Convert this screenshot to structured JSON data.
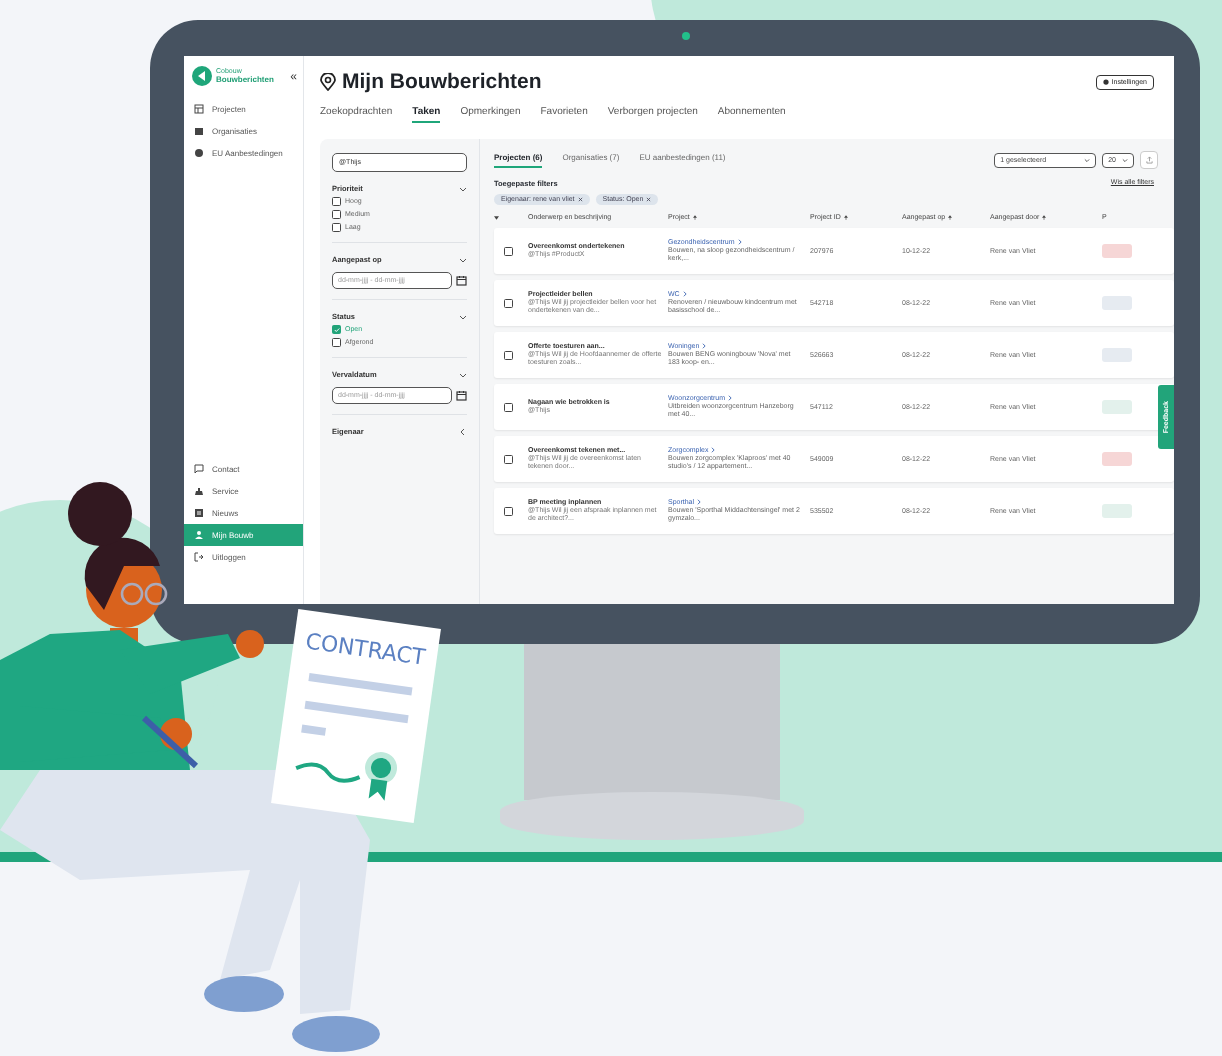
{
  "sidebar": {
    "logo_brand": "Cobouw",
    "logo_name": "Bouwberichten",
    "collapse_glyph": "«",
    "items": [
      {
        "label": "Projecten",
        "selected": false
      },
      {
        "label": "Organisaties",
        "selected": false
      },
      {
        "label": "EU Aanbestedingen",
        "selected": false
      }
    ],
    "bottom_items": [
      {
        "label": "Contact",
        "selected": false
      },
      {
        "label": "Service",
        "selected": false
      },
      {
        "label": "Nieuws",
        "selected": false
      },
      {
        "label": "Mijn Bouwb",
        "selected": true
      },
      {
        "label": "Uitloggen",
        "selected": false
      }
    ]
  },
  "header": {
    "title": "Mijn Bouwberichten",
    "settings_button": "Instellingen"
  },
  "tabs": [
    {
      "label": "Zoekopdrachten",
      "selected": false
    },
    {
      "label": "Taken",
      "selected": true
    },
    {
      "label": "Opmerkingen",
      "selected": false
    },
    {
      "label": "Favorieten",
      "selected": false
    },
    {
      "label": "Verborgen projecten",
      "selected": false
    },
    {
      "label": "Abonnementen",
      "selected": false
    }
  ],
  "filters": {
    "search": {
      "value": "@Thijs"
    },
    "sections": [
      {
        "title": "Prioriteit",
        "expanded": true,
        "kind": "checkboxes",
        "options": [
          {
            "label": "Hoog",
            "checked": false
          },
          {
            "label": "Medium",
            "checked": false
          },
          {
            "label": "Laag",
            "checked": false
          }
        ]
      },
      {
        "title": "Aangepast op",
        "expanded": true,
        "kind": "date",
        "placeholder": "dd-mm-jjjj - dd-mm-jjjj"
      },
      {
        "title": "Status",
        "expanded": true,
        "kind": "checkboxes",
        "options": [
          {
            "label": "Open",
            "checked": true
          },
          {
            "label": "Afgerond",
            "checked": false
          }
        ]
      },
      {
        "title": "Vervaldatum",
        "expanded": true,
        "kind": "date",
        "placeholder": "dd-mm-jjjj - dd-mm-jjjj"
      },
      {
        "title": "Eigenaar",
        "expanded": false,
        "kind": "none"
      }
    ]
  },
  "results": {
    "tabs": [
      {
        "label": "Projecten (6)",
        "selected": true
      },
      {
        "label": "Organisaties (7)",
        "selected": false
      },
      {
        "label": "EU aanbestedingen (11)",
        "selected": false
      }
    ],
    "selection_dropdown": "1 geselecteerd",
    "page_size_dropdown": "20",
    "applied_filters_label": "Toegepaste filters",
    "clear_filters_link": "Wis alle filters",
    "chips": [
      "Eigenaar: rene van vliet",
      "Status: Open"
    ],
    "table": {
      "columns": [
        {
          "label": "Onderwerp en beschrijving",
          "sortable": false
        },
        {
          "label": "Project",
          "sortable": true
        },
        {
          "label": "Project ID",
          "sortable": true
        },
        {
          "label": "Aangepast op",
          "sortable": true
        },
        {
          "label": "Aangepast door",
          "sortable": true
        },
        {
          "label": "P",
          "sortable": false
        }
      ],
      "rows": [
        {
          "selected": false,
          "subject": "Overeenkomst ondertekenen",
          "note": "@Thijs #ProductX",
          "project": "Gezondheidscentrum",
          "project_description": "Bouwen, na sloop gezondheidscentrum / kerk,...",
          "project_id": "207976",
          "modified_on": "10-12-22",
          "modified_by": "Rene van Vliet",
          "color": "#f6d6d6"
        },
        {
          "selected": false,
          "subject": "Projectleider bellen",
          "note": "@Thijs Wil jij projectleider bellen voor het ondertekenen van de...",
          "project": "WC",
          "project_description": "Renoveren / nieuwbouw kindcentrum met basisschool de...",
          "project_id": "542718",
          "modified_on": "08-12-22",
          "modified_by": "Rene van Vliet",
          "color": "#e6ebf1"
        },
        {
          "selected": false,
          "subject": "Offerte toesturen aan...",
          "note": "@Thijs Wil jij de Hoofdaannemer de offerte toesturen zoals...",
          "project": "Woningen",
          "project_description": "Bouwen BENG woningbouw 'Nova' met 183 koop- en...",
          "project_id": "526663",
          "modified_on": "08-12-22",
          "modified_by": "Rene van Vliet",
          "color": "#e6ebf1"
        },
        {
          "selected": false,
          "subject": "Nagaan wie betrokken is",
          "note": "@Thijs",
          "project": "Woonzorgcentrum",
          "project_description": "Uitbreiden woonzorgcentrum Hanzeborg met 40...",
          "project_id": "547112",
          "modified_on": "08-12-22",
          "modified_by": "Rene van Vliet",
          "color": "#e3f1ec"
        },
        {
          "selected": false,
          "subject": "Overeenkomst tekenen met...",
          "note": "@Thijs Wil jij de overeenkomst laten tekenen door...",
          "project": "Zorgcomplex",
          "project_description": "Bouwen zorgcomplex 'Klaproos' met 40 studio's / 12 appartement...",
          "project_id": "549009",
          "modified_on": "08-12-22",
          "modified_by": "Rene van Vliet",
          "color": "#f6d6d6"
        },
        {
          "selected": false,
          "subject": "BP meeting inplannen",
          "note": "@Thijs Wil jij een afspraak inplannen met de architect?...",
          "project": "Sporthal",
          "project_description": "Bouwen 'Sporthal Middachtensingel' met 2 gymzalo...",
          "project_id": "535502",
          "modified_on": "08-12-22",
          "modified_by": "Rene van Vliet",
          "color": "#e3f1ec"
        }
      ]
    }
  },
  "feedback_tab": "Feedback",
  "illustration": {
    "contract_title": "CONTRACT"
  }
}
